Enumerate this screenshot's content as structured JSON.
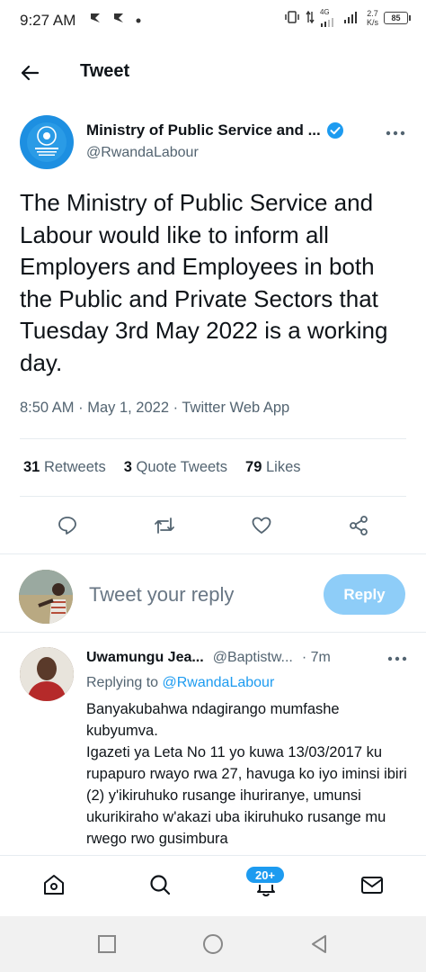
{
  "status_bar": {
    "time": "9:27 AM",
    "network_type": "4G",
    "net_speed_value": "2.7",
    "net_speed_unit": "K/s",
    "battery": "85"
  },
  "header": {
    "title": "Tweet"
  },
  "tweet": {
    "author_name": "Ministry of Public Service and ...",
    "author_handle": "@RwandaLabour",
    "text": "The Ministry of Public Service and Labour would like to inform all Employers and Employees in both the Public and Private Sectors that Tuesday 3rd May 2022 is a working day.",
    "meta": "8:50 AM · May 1, 2022 · Twitter Web App",
    "stats": {
      "retweets_count": "31",
      "retweets_label": "Retweets",
      "quotes_count": "3",
      "quotes_label": "Quote Tweets",
      "likes_count": "79",
      "likes_label": "Likes"
    }
  },
  "reply_box": {
    "placeholder": "Tweet your reply",
    "button_label": "Reply"
  },
  "reply_tweet": {
    "author_name": "Uwamungu Jea...",
    "author_handle": "@Baptistw...",
    "time": "· 7m",
    "replying_prefix": "Replying to",
    "replying_handle": "@RwandaLabour",
    "paragraph1": "Banyakubahwa ndagirango mumfashe kubyumva.",
    "paragraph2": "Igazeti ya Leta No 11 yo kuwa 13/03/2017 ku rupapuro rwayo rwa 27, havuga ko iyo iminsi ibiri (2) y'ikiruhuko rusange ihuriranye, umunsi ukurikiraho w'akazi uba ikiruhuko rusange mu rwego rwo gusimbura"
  },
  "bottom_nav": {
    "notification_badge": "20+"
  },
  "colors": {
    "accent": "#1d9bf0",
    "reply_button_disabled": "#8ecdf8",
    "secondary_text": "#536471"
  }
}
